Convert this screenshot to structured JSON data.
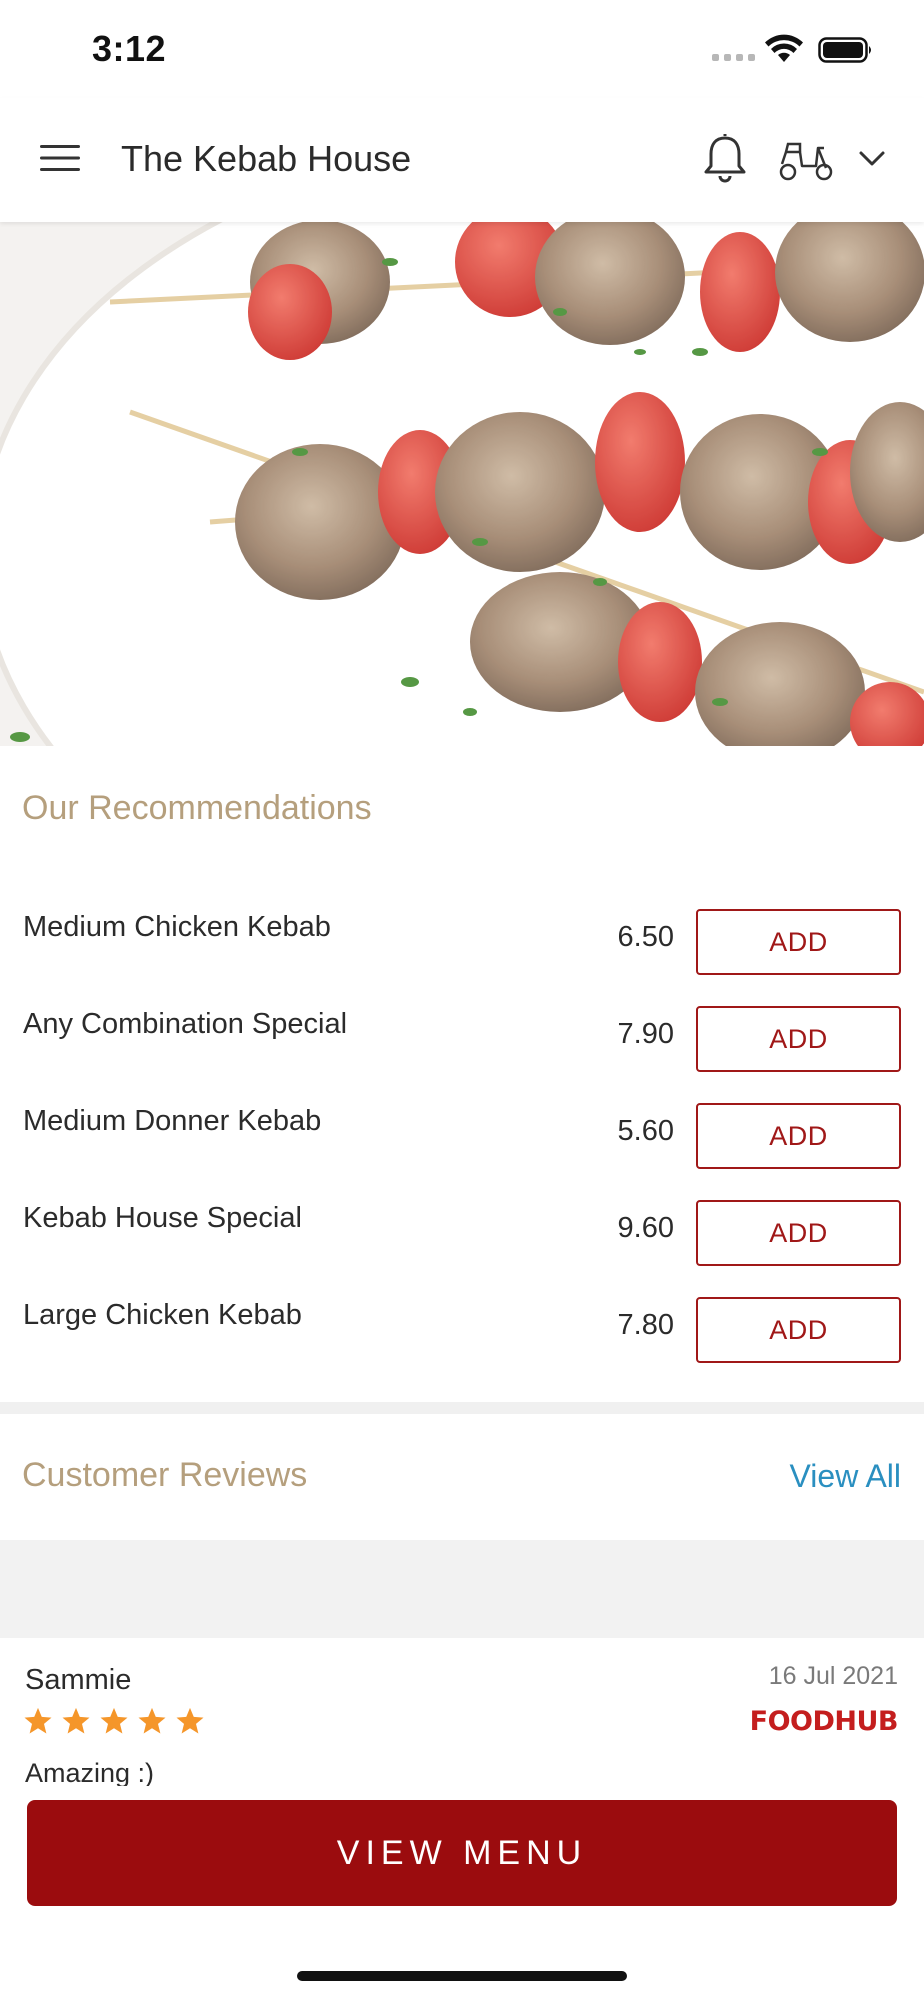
{
  "status_bar": {
    "time": "3:12"
  },
  "header": {
    "title": "The Kebab House",
    "icons": [
      "menu-icon",
      "bell-icon",
      "scooter-icon",
      "chevron-down-icon"
    ]
  },
  "hero": {
    "image": "chicken-kebab-skewers-photo"
  },
  "recommendations": {
    "title": "Our Recommendations",
    "add_label": "ADD",
    "items": [
      {
        "name": "Medium Chicken Kebab",
        "price": "6.50"
      },
      {
        "name": "Any Combination Special",
        "price": "7.90"
      },
      {
        "name": "Medium Donner Kebab",
        "price": "5.60"
      },
      {
        "name": "Kebab House Special",
        "price": "9.60"
      },
      {
        "name": "Large Chicken Kebab",
        "price": "7.80"
      }
    ]
  },
  "reviews": {
    "title": "Customer Reviews",
    "view_all": "View All",
    "items": [
      {
        "author": "Sammie",
        "date": "16 Jul 2021",
        "rating": 5,
        "source": "FOODHUB",
        "text": "Amazing :)"
      }
    ]
  },
  "cta": {
    "label": "VIEW MENU"
  },
  "colors": {
    "brand_red": "#9b0c0e",
    "section_title": "#b59f7d",
    "link_blue": "#2a8fc0",
    "star": "#f5962a"
  }
}
